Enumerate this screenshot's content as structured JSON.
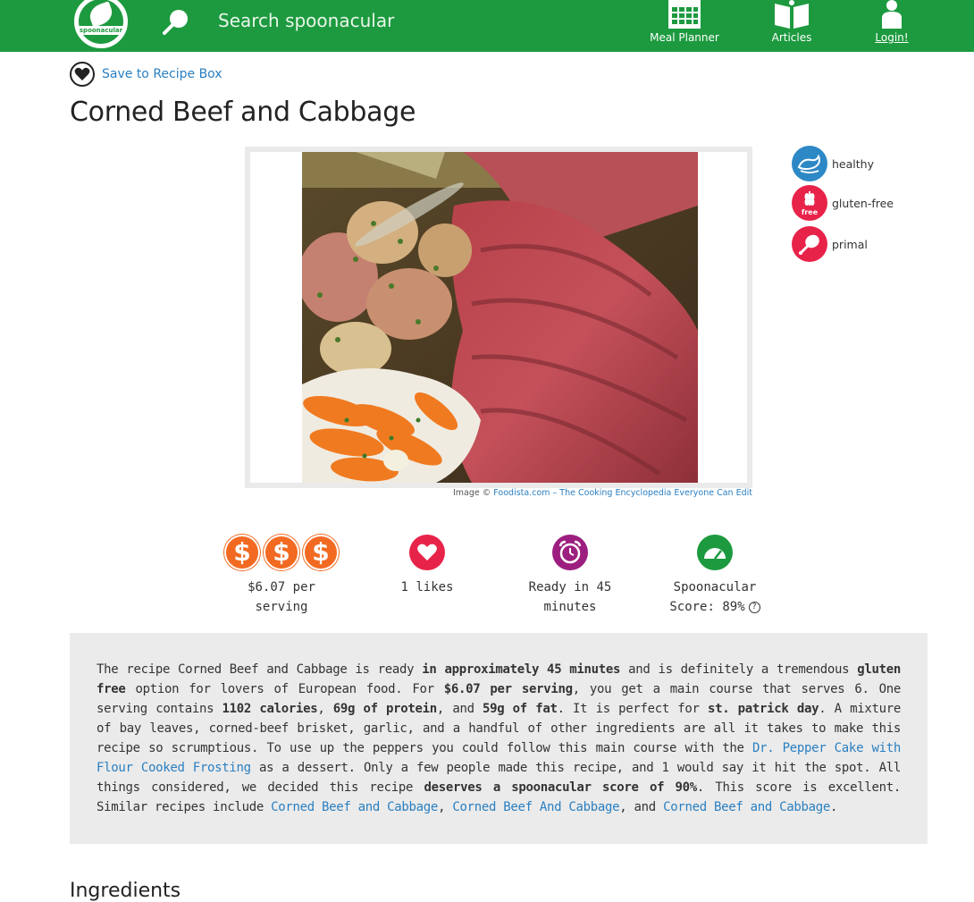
{
  "header": {
    "logo_text": "spoonacular",
    "search_placeholder": "Search spoonacular",
    "nav": [
      {
        "label": "Meal Planner",
        "icon": "calendar-icon"
      },
      {
        "label": "Articles",
        "icon": "book-icon"
      },
      {
        "label": "Login!",
        "icon": "user-icon"
      }
    ],
    "colors": {
      "brand": "#1d9a3f",
      "link": "#2a7fc1"
    }
  },
  "save": {
    "label": "Save to Recipe Box",
    "icon": "heart-icon"
  },
  "recipe": {
    "title": "Corned Beef and Cabbage",
    "image_credit_prefix": "Image ©",
    "image_credit_link": "Foodista.com – The Cooking Encyclopedia Everyone Can Edit"
  },
  "diets": [
    {
      "label": "healthy",
      "icon": "whale-icon",
      "color": "#2d88c6"
    },
    {
      "label": "gluten-free",
      "icon": "wheat-free-icon",
      "color": "#e8234a",
      "badge": "free"
    },
    {
      "label": "primal",
      "icon": "drumstick-icon",
      "color": "#e8234a"
    }
  ],
  "stats": {
    "price": {
      "coin": "$",
      "coin_count": 3,
      "text": "$6.07 per serving",
      "color": "#f26a21"
    },
    "likes": {
      "text": "1 likes",
      "icon": "heart-icon",
      "color": "#e8234a"
    },
    "time": {
      "text": "Ready in 45 minutes",
      "icon": "alarm-clock-icon",
      "color": "#9c1f7f"
    },
    "score": {
      "line1": "Spoonacular",
      "line2": "Score: 89%",
      "help": "?",
      "icon": "gauge-icon",
      "color": "#1d9a3f"
    }
  },
  "summary": {
    "t1": "The recipe Corned Beef and Cabbage is ready ",
    "b1": "in approximately 45 minutes",
    "t2": " and is definitely a tremendous ",
    "b2": "gluten free",
    "t3": " option for lovers of European food. For ",
    "b3": "$6.07 per serving",
    "t4": ", you get a main course that serves 6. One serving contains ",
    "b4": "1102 calories",
    "t5": ", ",
    "b5": "69g of protein",
    "t6": ", and ",
    "b6": "59g of fat",
    "t7": ". It is perfect for ",
    "b7": "st. patrick day",
    "t8": ". A mixture of bay leaves, corned-beef brisket, garlic, and a handful of other ingredients are all it takes to make this recipe so scrumptious. To use up the peppers you could follow this main course with the ",
    "l1": "Dr. Pepper Cake with Flour Cooked Frosting",
    "t9": " as a dessert. Only a few people made this recipe, and 1 would say it hit the spot. All things considered, we decided this recipe ",
    "b8": "deserves a spoonacular score of 90%",
    "t10": ". This score is excellent. Similar recipes include ",
    "l2": "Corned Beef and Cabbage",
    "t11": ", ",
    "l3": "Corned Beef And Cabbage",
    "t12": ", and ",
    "l4": "Corned Beef and Cabbage",
    "t13": "."
  },
  "sections": {
    "ingredients": "Ingredients"
  }
}
